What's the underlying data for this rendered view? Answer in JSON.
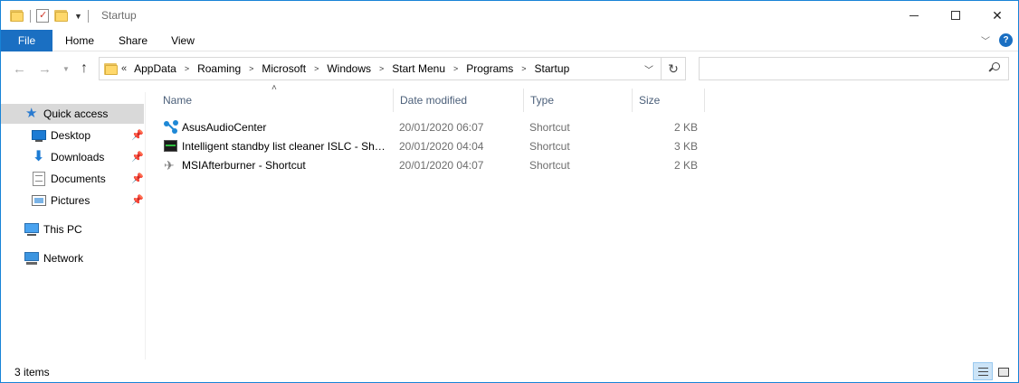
{
  "window": {
    "title": "Startup",
    "controls": {
      "minimize": "—",
      "maximize": "□",
      "close": "✕"
    }
  },
  "ribbon": {
    "tabs": [
      "File",
      "Home",
      "Share",
      "View"
    ],
    "help": "?"
  },
  "navigation": {
    "back": "←",
    "forward": "→",
    "up": "↑",
    "overflow": "«",
    "breadcrumbs": [
      "AppData",
      "Roaming",
      "Microsoft",
      "Windows",
      "Start Menu",
      "Programs",
      "Startup"
    ],
    "refresh": "↻",
    "search_placeholder": ""
  },
  "sidebar": {
    "items": [
      {
        "label": "Quick access",
        "icon": "star-icon",
        "selected": true,
        "pinned": false
      },
      {
        "label": "Desktop",
        "icon": "desktop-icon",
        "selected": false,
        "pinned": true
      },
      {
        "label": "Downloads",
        "icon": "downloads-icon",
        "selected": false,
        "pinned": true
      },
      {
        "label": "Documents",
        "icon": "documents-icon",
        "selected": false,
        "pinned": true
      },
      {
        "label": "Pictures",
        "icon": "pictures-icon",
        "selected": false,
        "pinned": true
      },
      {
        "label": "This PC",
        "icon": "computer-icon",
        "selected": false,
        "pinned": false
      },
      {
        "label": "Network",
        "icon": "network-icon",
        "selected": false,
        "pinned": false
      }
    ]
  },
  "columns": [
    "Name",
    "Date modified",
    "Type",
    "Size"
  ],
  "files": [
    {
      "name": "AsusAudioCenter",
      "date": "20/01/2020 06:07",
      "type": "Shortcut",
      "size": "2 KB",
      "icon": "asus-audio-icon"
    },
    {
      "name": "Intelligent standby list cleaner ISLC - Shortcut",
      "date": "20/01/2020 04:04",
      "type": "Shortcut",
      "size": "3 KB",
      "icon": "islc-icon"
    },
    {
      "name": "MSIAfterburner - Shortcut",
      "date": "20/01/2020 04:07",
      "type": "Shortcut",
      "size": "2 KB",
      "icon": "msi-afterburner-icon"
    }
  ],
  "status": {
    "item_count": "3 items"
  },
  "colors": {
    "accent": "#1a6fc2",
    "window_border": "#1883d7",
    "selected_nav": "#d9d9d9",
    "column_header_text": "#4c607a"
  }
}
